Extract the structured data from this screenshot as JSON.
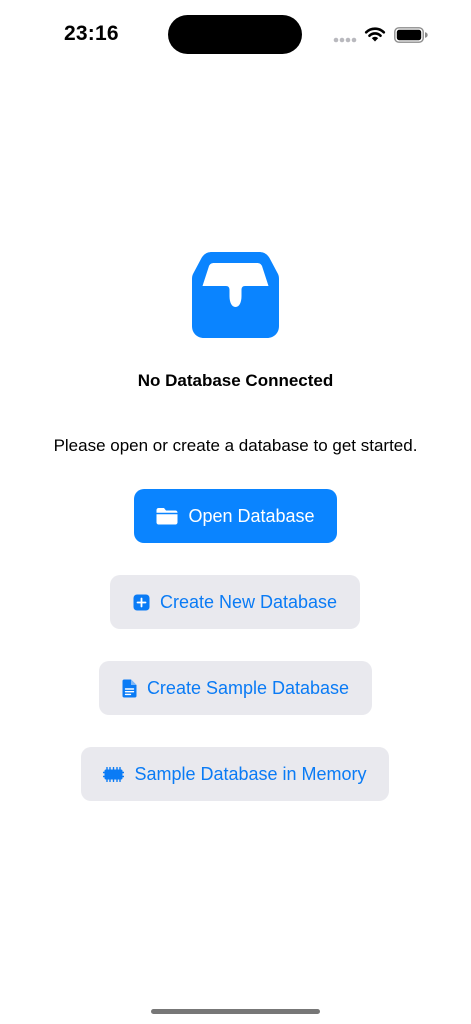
{
  "status_bar": {
    "time": "23:16",
    "icons": [
      "cellular-dots-icon",
      "wifi-icon",
      "battery-icon"
    ]
  },
  "empty_state": {
    "icon": "tray-icon",
    "title": "No Database Connected",
    "message": "Please open or create a database to get started."
  },
  "actions": {
    "open_database": {
      "label": "Open Database",
      "icon": "folder-icon"
    },
    "create_new": {
      "label": "Create New Database",
      "icon": "plus-square-icon"
    },
    "create_sample": {
      "label": "Create Sample Database",
      "icon": "document-icon"
    },
    "sample_memory": {
      "label": "Sample Database in Memory",
      "icon": "memory-chip-icon"
    }
  },
  "colors": {
    "accent": "#0a84ff",
    "secondary_bg": "#e9e9ee",
    "secondary_text": "#0a7bf5"
  }
}
